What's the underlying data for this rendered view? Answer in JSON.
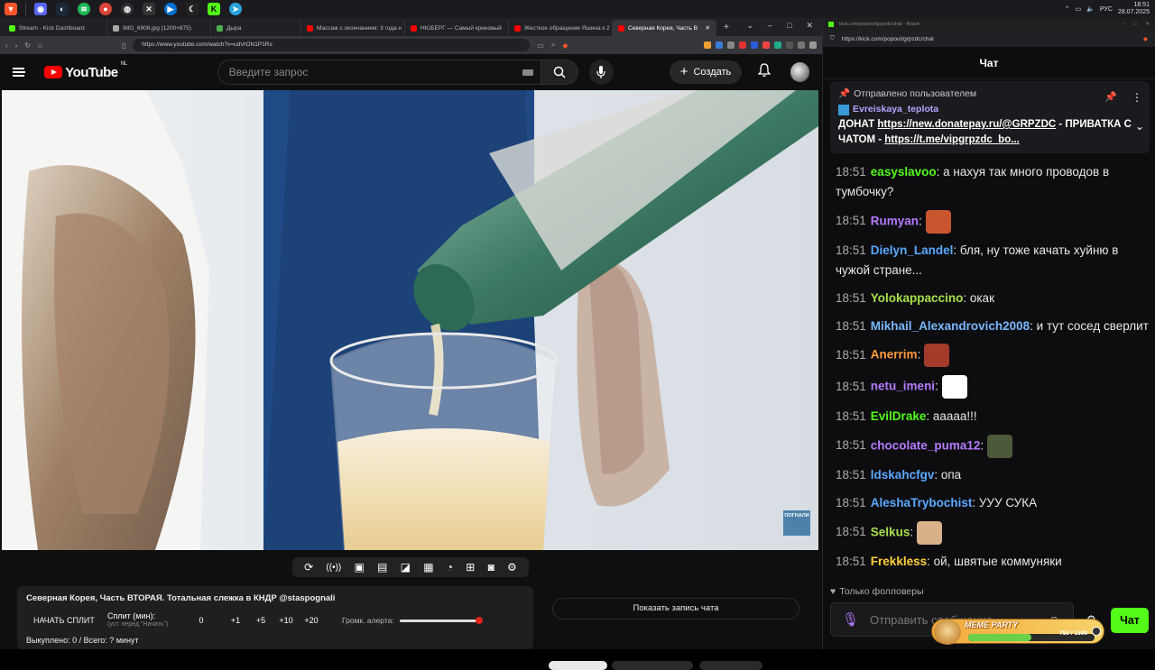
{
  "taskbar": {
    "icons": [
      "brave-icon",
      "discord-icon",
      "steam-icon",
      "spotify-icon",
      "chrome-icon",
      "obs-icon",
      "epic-icon",
      "ps-remote-icon",
      "moonlight-icon",
      "kick-icon",
      "telegram-icon"
    ],
    "tray": {
      "lang": "РУС",
      "time": "18:51",
      "date": "28.07.2025"
    }
  },
  "browser": {
    "tabs": [
      {
        "label": "Stream - Kick Dashboard",
        "color": "#53fc18"
      },
      {
        "label": "IMG_6908.jpg (1200×675)",
        "color": "#aaaaaa"
      },
      {
        "label": "Дыра",
        "color": "#4caf50"
      },
      {
        "label": "Массаж с окончанием: 3 года н",
        "color": "#ff0000"
      },
      {
        "label": "НЮБЕРГ — Самый криновый",
        "color": "#ff0000"
      },
      {
        "label": "Жесткое обращение Яшина к 2",
        "color": "#ff0000"
      },
      {
        "label": "Северная Корея, Часть В",
        "color": "#ff0000",
        "active": true
      }
    ],
    "url": "https://www.youtube.com/watch?v=udVrON1P1Rs"
  },
  "youtube": {
    "logo": "YouTube",
    "logo_sup": "NL",
    "search_placeholder": "Введите запрос",
    "create_label": "Создать"
  },
  "video": {
    "watermark": "ПОГНАЛИ"
  },
  "split_panel": {
    "title": "Северная Корея, Часть ВТОРАЯ. Тотальная слежка в КНДР @staspognali",
    "start_label": "НАЧАТЬ СПЛИТ",
    "minutes_label": "Сплит (мин):",
    "minutes_sub": "(уст. перед \"Начать\")",
    "minutes_value": "0",
    "increments": [
      "+1",
      "+5",
      "+10",
      "+20"
    ],
    "alert_label": "Громк. алерта:",
    "alert_volume": 1.0,
    "footer": "Выкуплено: 0 / Всего: ? минут"
  },
  "show_chat_label": "Показать запись чата",
  "chat": {
    "window_url_title": "kick.com/popout/grpzdc/chat - Brave",
    "url": "https://kick.com/popout/grpzdc/chat",
    "header": "Чат",
    "pinned": {
      "head": "Отправлено пользователем",
      "user": "Evreiskaya_teplota",
      "text_pre": "ДОНАТ ",
      "link1": "https://new.donatepay.ru/@GRPZDC",
      "text_mid": " - ПРИВАТКА С ЧАТОМ - ",
      "link2": "https://t.me/vipgrpzdc_bo..."
    },
    "messages": [
      {
        "time": "18:51",
        "user": "easyslavoo",
        "color": "#53fc18",
        "text": "а нахуя так много проводов в тумбочку?"
      },
      {
        "time": "18:51",
        "user": "Rumyan",
        "color": "#b57aff",
        "text": "",
        "emote": "#c9562e"
      },
      {
        "time": "18:51",
        "user": "Dielyn_Landel",
        "color": "#5aa9ff",
        "text": "бля, ну тоже качать хуйню в чужой стране..."
      },
      {
        "time": "18:51",
        "user": "Yolokappaccino",
        "color": "#a8e04a",
        "text": "окак"
      },
      {
        "time": "18:51",
        "user": "Mikhail_Alexandrovich2008",
        "color": "#7ab8ff",
        "text": "и тут сосед сверлит"
      },
      {
        "time": "18:51",
        "user": "Anerrim",
        "color": "#ff9a3c",
        "text": "",
        "emote": "#a33a2a"
      },
      {
        "time": "18:51",
        "user": "netu_imeni",
        "color": "#b57aff",
        "text": "",
        "emote": "#ffffff"
      },
      {
        "time": "18:51",
        "user": "EvilDrake",
        "color": "#53fc18",
        "text": "ааааа!!!"
      },
      {
        "time": "18:51",
        "user": "chocolate_puma12",
        "color": "#b57aff",
        "text": "",
        "emote": "#4d5a3a"
      },
      {
        "time": "18:51",
        "user": "ldskahcfgv",
        "color": "#5aa9ff",
        "text": "опа"
      },
      {
        "time": "18:51",
        "user": "AleshaTrybochist",
        "color": "#5aa9ff",
        "text": "УУУ СУКА"
      },
      {
        "time": "18:51",
        "user": "Selkus",
        "color": "#a8e04a",
        "text": "",
        "emote": "#d8b08a"
      },
      {
        "time": "18:51",
        "user": "Frekkless",
        "color": "#ffcf3c",
        "text": "ой, швятые коммуняки"
      }
    ],
    "followers_only": "Только фолловеры",
    "input_placeholder": "Отправить сообщение",
    "send_label": "Чат"
  },
  "meme_party": {
    "title": "MEME PARTY",
    "progress": "750 / 1500",
    "progress_fraction": 0.5
  }
}
